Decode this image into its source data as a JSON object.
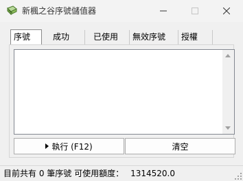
{
  "window": {
    "title": "新楓之谷序號儲值器"
  },
  "tabs": [
    {
      "label": "序號",
      "active": true
    },
    {
      "label": "成功",
      "active": false
    },
    {
      "label": "已使用",
      "active": false
    },
    {
      "label": "無效序號",
      "active": false
    },
    {
      "label": "授權",
      "active": false
    }
  ],
  "list": {
    "items": []
  },
  "buttons": {
    "execute_label": "執行 (F12)",
    "clear_label": "清空"
  },
  "status": {
    "text": "目前共有 0 筆序號  可使用額度：",
    "value": "1314520.0"
  },
  "icons": {
    "app": "notebook-icon",
    "minimize": "minimize-icon",
    "maximize": "maximize-icon",
    "close": "close-icon"
  }
}
